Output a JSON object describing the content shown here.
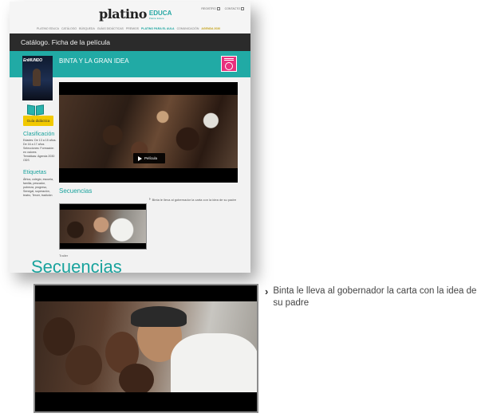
{
  "header": {
    "logo_text": "platino",
    "logo_educa": "EDUCA",
    "logo_subtitle": "Platino Educa",
    "top_links": [
      "REGISTRO",
      "CONTACTO"
    ],
    "nav": [
      "PLATINO EDUCA",
      "CATÁLOGO",
      "BÚSQUEDA",
      "GUÍAS DIDÁCTICAS",
      "PREMIOS",
      "PLATINO PARA EL AULA",
      "COMUNICACIÓN",
      "AGENDA 2030"
    ]
  },
  "page_bar": {
    "text": "Catálogo. Ficha de la película"
  },
  "movie": {
    "title": "BINTA Y LA GRAN IDEA",
    "poster_title": "EnMUNDO",
    "guide_button": "Guía didáctica",
    "play_label": "Película"
  },
  "sidebar": {
    "clasificacion_title": "Clasificación",
    "clasificacion_lines": [
      "Edades: De 13 a 15 años. De 16 a 17 años",
      "Selecciones: Formación en valores",
      "Temáticas: Agenda 2030 ODS"
    ],
    "etiquetas_title": "Etiquetas",
    "etiquetas_text": "África, colegio, escuela, familia, pescador, pobreza, progreso, Senegal, superación, teatro, Tercer, tradición"
  },
  "sequences": {
    "title": "Secuencias",
    "items": [
      {
        "label": "Binta le lleva al gobernador la carta con la idea de su padre"
      }
    ],
    "bottom_label": "Trailer"
  },
  "colors": {
    "accent_teal": "#21aaa5",
    "page_bar": "#2b2b2b",
    "guide_yellow": "#f2c900",
    "badge_pink": "#e8317e"
  }
}
